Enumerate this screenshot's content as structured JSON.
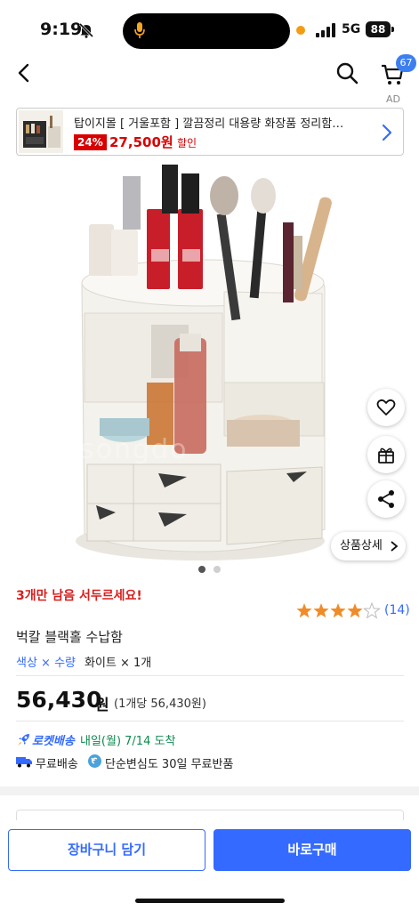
{
  "status_bar": {
    "time": "9:19",
    "network": "5G",
    "battery": "88",
    "icons": [
      "bell-slash-icon",
      "microphone-icon",
      "signal-icon"
    ]
  },
  "nav": {
    "cart_count": "67",
    "icons": [
      "back-arrow-icon",
      "search-icon",
      "cart-icon"
    ]
  },
  "ad": {
    "label": "AD",
    "title": "탑이지몰 [ 거울포함 ] 깔끔정리 대용량 화장품 정리함…",
    "discount": "24%",
    "price": "27,500원",
    "sale_label": "할인"
  },
  "gallery": {
    "watermark": "songdo",
    "detail_button": "상품상세",
    "current_index": 1,
    "total": 2,
    "icons": [
      "heart-icon",
      "gift-icon",
      "share-icon"
    ]
  },
  "product": {
    "urgency": "3개만 남음 서두르세요!",
    "rating": 4,
    "rating_max": 5,
    "review_count": "(14)",
    "name": "벅칼 블랙홀 수납함",
    "option_key": "색상 × 수량",
    "option_value": "화이트 × 1개",
    "price": "56,430",
    "price_unit": "원",
    "unit_price": "(1개당 56,430원)",
    "rocket_label": "로켓배송",
    "delivery_date": "내일(월) 7/14 도착",
    "free_shipping": "무료배송",
    "free_return": "단순변심도 30일 무료반품"
  },
  "bottom": {
    "cart_button": "장바구니 담기",
    "buy_button": "바로구매"
  },
  "colors": {
    "accent": "#346aff",
    "urgent": "#d81e1e",
    "star": "#f08c28",
    "delivery": "#0e8a4f"
  }
}
